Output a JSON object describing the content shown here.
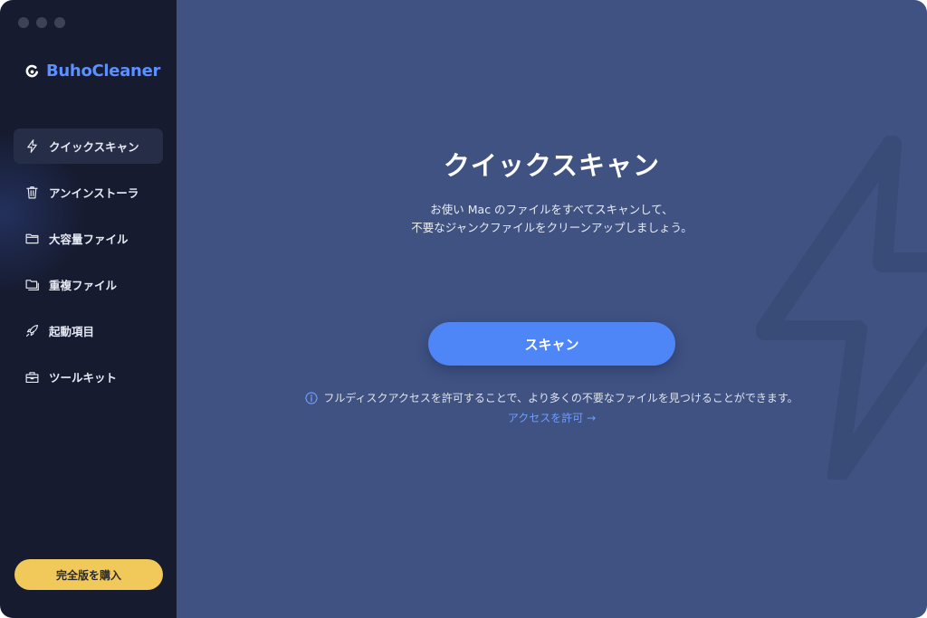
{
  "app": {
    "name": "BuhoCleaner"
  },
  "sidebar": {
    "items": [
      {
        "label": "クイックスキャン",
        "icon": "lightning-icon",
        "active": true
      },
      {
        "label": "アンインストーラ",
        "icon": "trash-icon",
        "active": false
      },
      {
        "label": "大容量ファイル",
        "icon": "folder-icon",
        "active": false
      },
      {
        "label": "重複ファイル",
        "icon": "duplicate-folder-icon",
        "active": false
      },
      {
        "label": "起動項目",
        "icon": "rocket-icon",
        "active": false
      },
      {
        "label": "ツールキット",
        "icon": "toolbox-icon",
        "active": false
      }
    ],
    "buy_label": "完全版を購入"
  },
  "main": {
    "title": "クイックスキャン",
    "description_line1": "お使い Mac のファイルをすべてスキャンして、",
    "description_line2": "不要なジャンクファイルをクリーンアップしましょう。",
    "scan_label": "スキャン",
    "notice": "フルディスクアクセスを許可することで、より多くの不要なファイルを見つけることができます。",
    "access_link": "アクセスを許可 →"
  },
  "colors": {
    "sidebar_bg": "#161b30",
    "main_bg": "#3f5282",
    "accent_blue": "#4f86f7",
    "brand_blue": "#5c8fff",
    "buy_yellow": "#f1c85a"
  }
}
